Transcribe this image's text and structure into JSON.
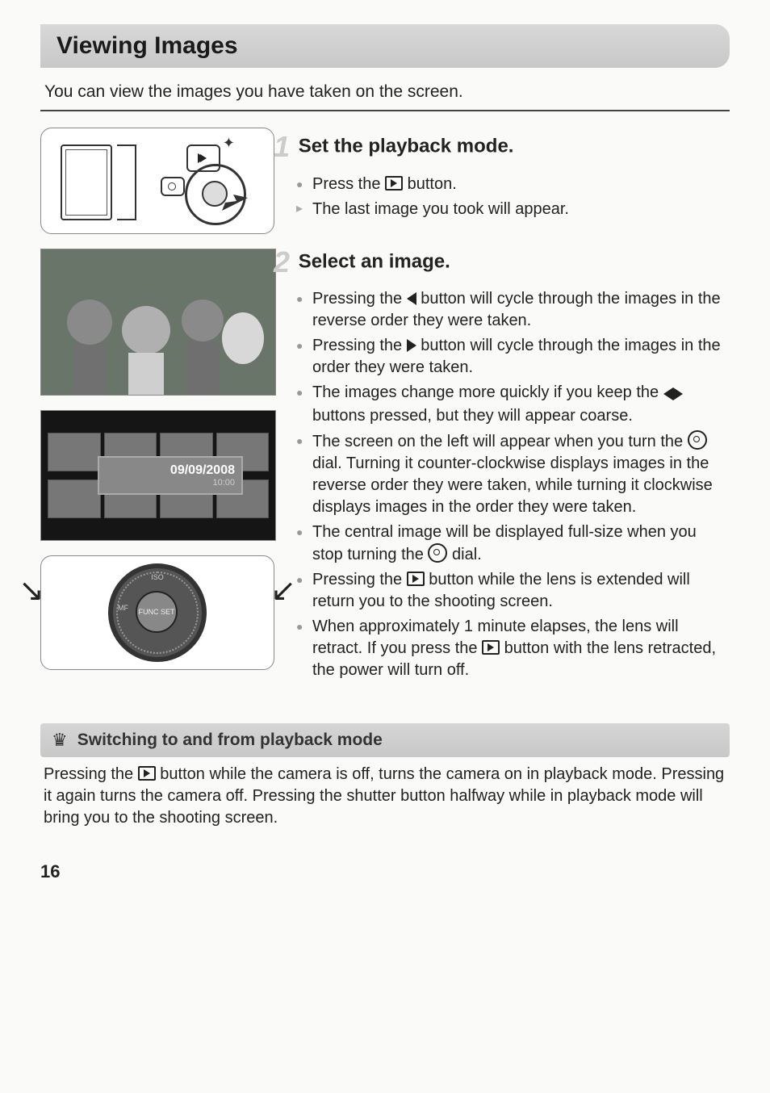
{
  "title": "Viewing Images",
  "intro": "You can view the images you have taken on the screen.",
  "step1": {
    "number": "1",
    "heading": "Set the playback mode.",
    "bullets": {
      "b1_pre": "Press the ",
      "b1_post": " button.",
      "b2": "The last image you took will appear."
    }
  },
  "step2": {
    "number": "2",
    "heading": "Select an image.",
    "bullets": {
      "b1_pre": "Pressing the ",
      "b1_post": " button will cycle through the images in the reverse order they were taken.",
      "b2_pre": "Pressing the ",
      "b2_post": " button will cycle through the images in the order they were taken.",
      "b3_pre": "The images change more quickly if you keep the ",
      "b3_post": " buttons pressed, but they will appear coarse.",
      "b4_pre": "The screen on the left will appear when you turn the ",
      "b4_post": " dial. Turning it counter-clockwise displays images in the reverse order they were taken, while turning it clockwise displays images in the order they were taken.",
      "b5_pre": "The central image will be displayed full-size when you stop turning the ",
      "b5_post": " dial.",
      "b6_pre": "Pressing the ",
      "b6_post": " button while the lens is extended will return you to the shooting screen.",
      "b7_pre": "When approximately 1 minute elapses, the lens will retract. If you press the ",
      "b7_post": " button with the lens retracted, the power will turn off."
    }
  },
  "filmstrip": {
    "date": "09/09/2008",
    "time": "10:00"
  },
  "dial_labels": {
    "top": "ISO",
    "center": "FUNC SET",
    "left": "MF"
  },
  "tip": {
    "heading": "Switching to and from playback mode",
    "body_pre": "Pressing the ",
    "body_post": " button while the camera is off, turns the camera on in playback mode. Pressing it again turns the camera off. Pressing the shutter button halfway while in playback mode will bring you to the shooting screen."
  },
  "page_number": "16"
}
